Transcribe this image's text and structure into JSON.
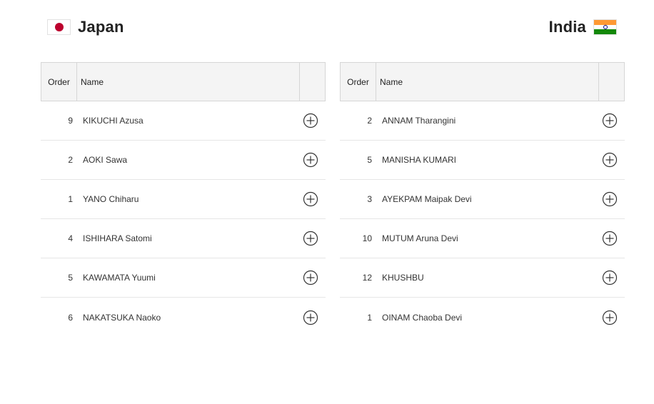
{
  "teams": [
    {
      "name": "Japan",
      "flag_icon": "japan-flag-icon",
      "columns": {
        "order": "Order",
        "name": "Name"
      },
      "players": [
        {
          "order": "9",
          "name": "KIKUCHI Azusa"
        },
        {
          "order": "2",
          "name": "AOKI Sawa"
        },
        {
          "order": "1",
          "name": "YANO Chiharu"
        },
        {
          "order": "4",
          "name": "ISHIHARA Satomi"
        },
        {
          "order": "5",
          "name": "KAWAMATA Yuumi"
        },
        {
          "order": "6",
          "name": "NAKATSUKA Naoko"
        }
      ]
    },
    {
      "name": "India",
      "flag_icon": "india-flag-icon",
      "columns": {
        "order": "Order",
        "name": "Name"
      },
      "players": [
        {
          "order": "2",
          "name": "ANNAM Tharangini"
        },
        {
          "order": "5",
          "name": "MANISHA KUMARI"
        },
        {
          "order": "3",
          "name": "AYEKPAM Maipak Devi"
        },
        {
          "order": "10",
          "name": "MUTUM Aruna Devi"
        },
        {
          "order": "12",
          "name": "KHUSHBU"
        },
        {
          "order": "1",
          "name": "OINAM Chaoba Devi"
        }
      ]
    }
  ],
  "colors": {
    "accent_text": "#222222",
    "border": "#d6d6d6",
    "header_bg": "#f4f4f4",
    "japan_red": "#bc002d",
    "india_saffron": "#ff9933",
    "india_green": "#138808"
  },
  "icons": {
    "expand": "plus-circle-icon"
  }
}
